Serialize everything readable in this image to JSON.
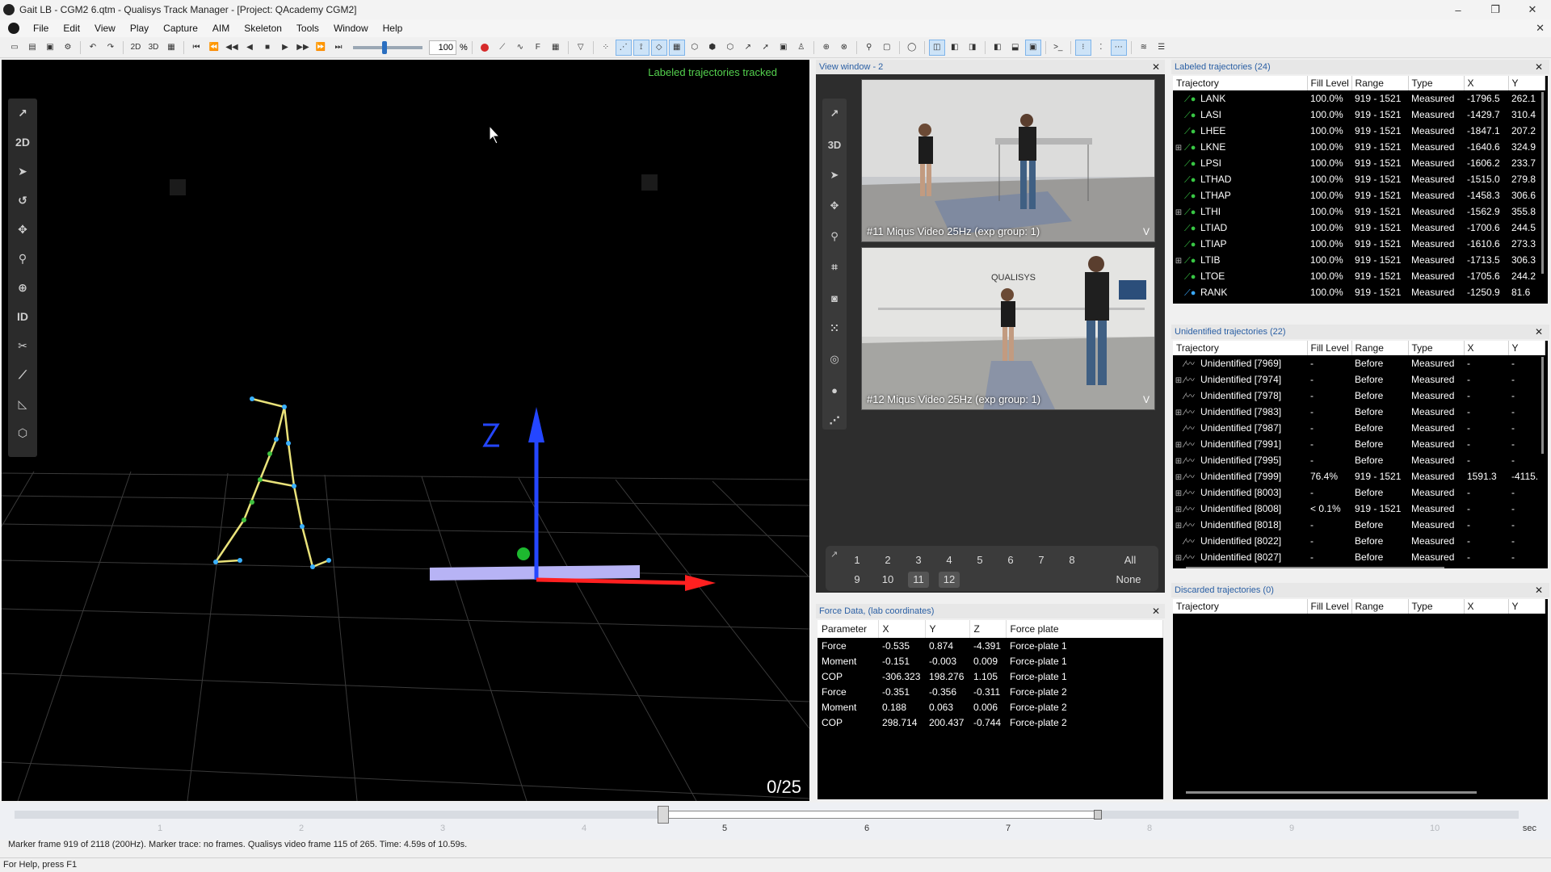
{
  "window": {
    "title": "Gait LB - CGM2 6.qtm - Qualisys Track Manager - [Project: QAcademy CGM2]",
    "controls": [
      "–",
      "❐",
      "✕"
    ]
  },
  "menu": [
    "File",
    "Edit",
    "View",
    "Play",
    "Capture",
    "AIM",
    "Skeleton",
    "Tools",
    "Window",
    "Help"
  ],
  "toolbar": {
    "label_2d": "2D",
    "label_3d": "3D",
    "speed_value": "100",
    "speed_unit": "%",
    "f_label": "F"
  },
  "view3d": {
    "status": "Labeled trajectories tracked",
    "frame_counter": "0/25",
    "tools": [
      "2D"
    ],
    "id_label": "ID"
  },
  "view_window": {
    "title": "View window - 2",
    "mode_3d": "3D",
    "cameras": [
      {
        "label": "#11 Miqus Video 25Hz (exp group: 1)",
        "flag": "V"
      },
      {
        "label": "#12 Miqus Video 25Hz (exp group: 1)",
        "flag": "V"
      }
    ],
    "camera_numbers_row1": [
      "1",
      "2",
      "3",
      "4",
      "5",
      "6",
      "7",
      "8"
    ],
    "camera_numbers_row2": [
      "9",
      "10",
      "11",
      "12"
    ],
    "all_label": "All",
    "none_label": "None",
    "brand_text": "QUALISYS"
  },
  "force_data": {
    "title": "Force Data,  (lab coordinates)",
    "columns": [
      "Parameter",
      "X",
      "Y",
      "Z",
      "Force plate"
    ],
    "rows": [
      [
        "Force",
        "-0.535",
        "0.874",
        "-4.391",
        "Force-plate 1"
      ],
      [
        "Moment",
        "-0.151",
        "-0.003",
        "0.009",
        "Force-plate 1"
      ],
      [
        "COP",
        "-306.323",
        "198.276",
        "1.105",
        "Force-plate 1"
      ],
      [
        "Force",
        "-0.351",
        "-0.356",
        "-0.311",
        "Force-plate 2"
      ],
      [
        "Moment",
        "0.188",
        "0.063",
        "0.006",
        "Force-plate 2"
      ],
      [
        "COP",
        "298.714",
        "200.437",
        "-0.744",
        "Force-plate 2"
      ]
    ]
  },
  "labeled": {
    "title": "Labeled trajectories (24)",
    "columns": [
      "Trajectory",
      "Fill Level",
      "Range",
      "Type",
      "X",
      "Y"
    ],
    "rows": [
      {
        "expand": "",
        "icon": "green",
        "name": "LANK",
        "fill": "100.0%",
        "range": "919 - 1521",
        "type": "Measured",
        "x": "-1796.5",
        "y": "262.1"
      },
      {
        "expand": "",
        "icon": "green",
        "name": "LASI",
        "fill": "100.0%",
        "range": "919 - 1521",
        "type": "Measured",
        "x": "-1429.7",
        "y": "310.4"
      },
      {
        "expand": "",
        "icon": "green",
        "name": "LHEE",
        "fill": "100.0%",
        "range": "919 - 1521",
        "type": "Measured",
        "x": "-1847.1",
        "y": "207.2"
      },
      {
        "expand": "⊞",
        "icon": "green",
        "name": "LKNE",
        "fill": "100.0%",
        "range": "919 - 1521",
        "type": "Measured",
        "x": "-1640.6",
        "y": "324.9"
      },
      {
        "expand": "",
        "icon": "green",
        "name": "LPSI",
        "fill": "100.0%",
        "range": "919 - 1521",
        "type": "Measured",
        "x": "-1606.2",
        "y": "233.7"
      },
      {
        "expand": "",
        "icon": "green",
        "name": "LTHAD",
        "fill": "100.0%",
        "range": "919 - 1521",
        "type": "Measured",
        "x": "-1515.0",
        "y": "279.8"
      },
      {
        "expand": "",
        "icon": "green",
        "name": "LTHAP",
        "fill": "100.0%",
        "range": "919 - 1521",
        "type": "Measured",
        "x": "-1458.3",
        "y": "306.6"
      },
      {
        "expand": "⊞",
        "icon": "green",
        "name": "LTHI",
        "fill": "100.0%",
        "range": "919 - 1521",
        "type": "Measured",
        "x": "-1562.9",
        "y": "355.8"
      },
      {
        "expand": "",
        "icon": "green",
        "name": "LTIAD",
        "fill": "100.0%",
        "range": "919 - 1521",
        "type": "Measured",
        "x": "-1700.6",
        "y": "244.5"
      },
      {
        "expand": "",
        "icon": "green",
        "name": "LTIAP",
        "fill": "100.0%",
        "range": "919 - 1521",
        "type": "Measured",
        "x": "-1610.6",
        "y": "273.3"
      },
      {
        "expand": "⊞",
        "icon": "green",
        "name": "LTIB",
        "fill": "100.0%",
        "range": "919 - 1521",
        "type": "Measured",
        "x": "-1713.5",
        "y": "306.3"
      },
      {
        "expand": "",
        "icon": "green",
        "name": "LTOE",
        "fill": "100.0%",
        "range": "919 - 1521",
        "type": "Measured",
        "x": "-1705.6",
        "y": "244.2"
      },
      {
        "expand": "",
        "icon": "blue",
        "name": "RANK",
        "fill": "100.0%",
        "range": "919 - 1521",
        "type": "Measured",
        "x": "-1250.9",
        "y": "81.6"
      }
    ]
  },
  "unidentified": {
    "title": "Unidentified trajectories (22)",
    "columns": [
      "Trajectory",
      "Fill Level",
      "Range",
      "Type",
      "X",
      "Y"
    ],
    "rows": [
      {
        "expand": "",
        "name": "Unidentified [7969]",
        "fill": "-",
        "range": "Before",
        "type": "Measured",
        "x": "-",
        "y": "-"
      },
      {
        "expand": "⊞",
        "name": "Unidentified [7974]",
        "fill": "-",
        "range": "Before",
        "type": "Measured",
        "x": "-",
        "y": "-"
      },
      {
        "expand": "",
        "name": "Unidentified [7978]",
        "fill": "-",
        "range": "Before",
        "type": "Measured",
        "x": "-",
        "y": "-"
      },
      {
        "expand": "⊞",
        "name": "Unidentified [7983]",
        "fill": "-",
        "range": "Before",
        "type": "Measured",
        "x": "-",
        "y": "-"
      },
      {
        "expand": "",
        "name": "Unidentified [7987]",
        "fill": "-",
        "range": "Before",
        "type": "Measured",
        "x": "-",
        "y": "-"
      },
      {
        "expand": "⊞",
        "name": "Unidentified [7991]",
        "fill": "-",
        "range": "Before",
        "type": "Measured",
        "x": "-",
        "y": "-"
      },
      {
        "expand": "⊞",
        "name": "Unidentified [7995]",
        "fill": "-",
        "range": "Before",
        "type": "Measured",
        "x": "-",
        "y": "-"
      },
      {
        "expand": "⊞",
        "name": "Unidentified [7999]",
        "fill": "76.4%",
        "range": "919 - 1521",
        "type": "Measured",
        "x": "1591.3",
        "y": "-4115."
      },
      {
        "expand": "⊞",
        "name": "Unidentified [8003]",
        "fill": "-",
        "range": "Before",
        "type": "Measured",
        "x": "-",
        "y": "-"
      },
      {
        "expand": "⊞",
        "name": "Unidentified [8008]",
        "fill": "< 0.1%",
        "range": "919 - 1521",
        "type": "Measured",
        "x": "-",
        "y": "-"
      },
      {
        "expand": "⊞",
        "name": "Unidentified [8018]",
        "fill": "-",
        "range": "Before",
        "type": "Measured",
        "x": "-",
        "y": "-"
      },
      {
        "expand": "",
        "name": "Unidentified [8022]",
        "fill": "-",
        "range": "Before",
        "type": "Measured",
        "x": "-",
        "y": "-"
      },
      {
        "expand": "⊞",
        "name": "Unidentified [8027]",
        "fill": "-",
        "range": "Before",
        "type": "Measured",
        "x": "-",
        "y": "-"
      }
    ]
  },
  "discarded": {
    "title": "Discarded trajectories (0)",
    "columns": [
      "Trajectory",
      "Fill Level",
      "Range",
      "Type",
      "X",
      "Y"
    ]
  },
  "timeline": {
    "ticks": [
      "1",
      "2",
      "3",
      "4",
      "5",
      "6",
      "7",
      "8",
      "9",
      "10"
    ],
    "unit": "sec",
    "info": "Marker frame 919 of 2118 (200Hz). Marker trace: no frames. Qualisys video frame 115 of 265. Time: 4.59s of 10.59s."
  },
  "statusbar": "For Help, press F1"
}
